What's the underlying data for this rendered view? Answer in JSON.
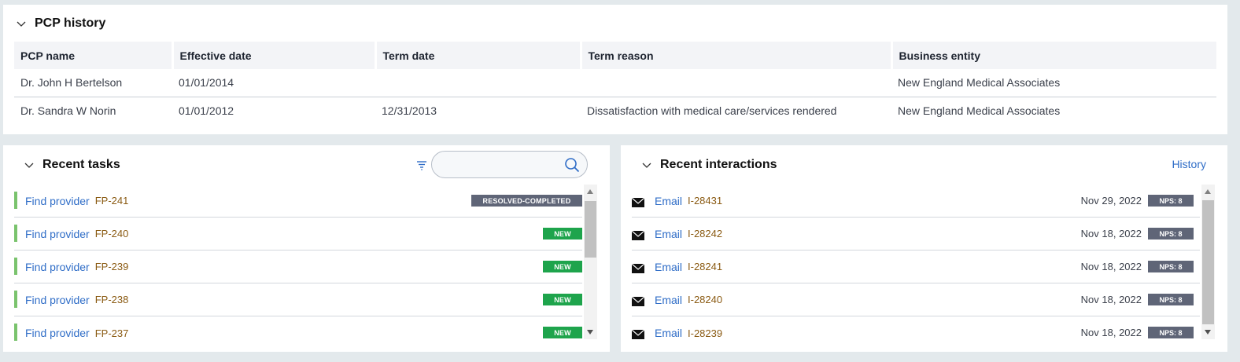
{
  "pcp_history": {
    "title": "PCP history",
    "columns": [
      "PCP name",
      "Effective date",
      "Term date",
      "Term reason",
      "Business entity"
    ],
    "rows": [
      [
        "Dr. John H Bertelson",
        "01/01/2014",
        "",
        "",
        "New England Medical Associates"
      ],
      [
        "Dr. Sandra W Norin",
        "01/01/2012",
        "12/31/2013",
        "Dissatisfaction with medical care/services rendered",
        "New England Medical Associates"
      ]
    ]
  },
  "recent_tasks": {
    "title": "Recent tasks",
    "search": {
      "value": "",
      "placeholder": ""
    },
    "items": [
      {
        "label": "Find provider",
        "id": "FP-241",
        "status": "RESOLVED-COMPLETED"
      },
      {
        "label": "Find provider",
        "id": "FP-240",
        "status": "NEW"
      },
      {
        "label": "Find provider",
        "id": "FP-239",
        "status": "NEW"
      },
      {
        "label": "Find provider",
        "id": "FP-238",
        "status": "NEW"
      },
      {
        "label": "Find provider",
        "id": "FP-237",
        "status": "NEW"
      }
    ]
  },
  "recent_interactions": {
    "title": "Recent interactions",
    "history_label": "History",
    "items": [
      {
        "type": "Email",
        "id": "I-28431",
        "date": "Nov 29, 2022",
        "nps": "NPS: 8"
      },
      {
        "type": "Email",
        "id": "I-28242",
        "date": "Nov 18, 2022",
        "nps": "NPS: 8"
      },
      {
        "type": "Email",
        "id": "I-28241",
        "date": "Nov 18, 2022",
        "nps": "NPS: 8"
      },
      {
        "type": "Email",
        "id": "I-28240",
        "date": "Nov 18, 2022",
        "nps": "NPS: 8"
      },
      {
        "type": "Email",
        "id": "I-28239",
        "date": "Nov 18, 2022",
        "nps": "NPS: 8"
      }
    ]
  },
  "colors": {
    "link": "#2f6dc7",
    "id_text": "#8a5a12",
    "status_new": "#1ea44c",
    "status_resolved": "#5f6577",
    "task_stripe": "#7ac36d"
  },
  "icons": {
    "collapse": "chevron-down-icon",
    "filter": "filter-icon",
    "search": "search-icon",
    "email": "envelope-icon"
  }
}
